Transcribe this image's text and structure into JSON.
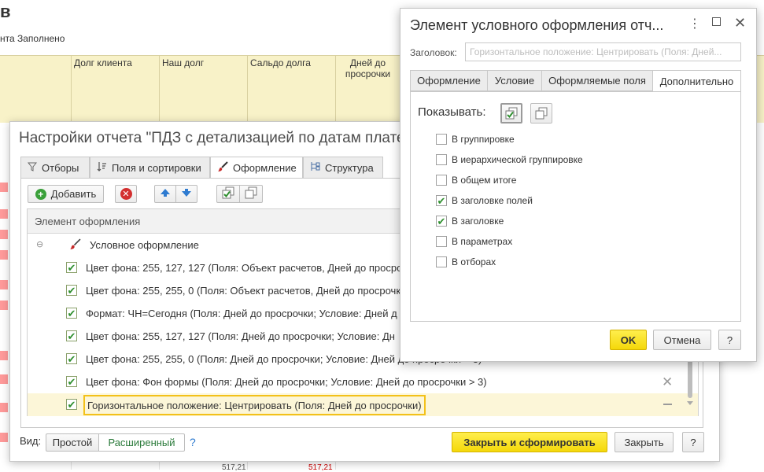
{
  "background_report": {
    "title_fragment": "в",
    "subtitle_fragment": "нта Заполнено",
    "headers": [
      "Долг клиента",
      "Наш долг",
      "Сальдо долга",
      "Дней до просрочки"
    ],
    "bottom_values": [
      "517,21",
      "517,21"
    ]
  },
  "settings_dialog": {
    "title": "Настройки отчета \"ПДЗ с детализацией по датам плате",
    "tabs": [
      {
        "label": "Отборы",
        "icon": "filter-icon"
      },
      {
        "label": "Поля и сортировки",
        "icon": "sort-icon"
      },
      {
        "label": "Оформление",
        "icon": "brush-icon"
      },
      {
        "label": "Структура",
        "icon": "structure-icon"
      }
    ],
    "active_tab": "Оформление",
    "toolbar": {
      "add_label": "Добавить"
    },
    "column_header": "Элемент оформления",
    "group_label": "Условное оформление",
    "rows": [
      {
        "text": "Цвет фона: 255, 127, 127 (Поля: Объект расчетов, Дней до просроч",
        "checked": true
      },
      {
        "text": "Цвет фона: 255, 255, 0 (Поля: Объект расчетов, Дней до просрочк",
        "checked": true
      },
      {
        "text": "Формат: ЧН=Сегодня (Поля: Дней до просрочки; Условие: Дней д",
        "checked": true
      },
      {
        "text": "Цвет фона: 255, 127, 127 (Поля: Дней до просрочки; Условие: Дн",
        "checked": true
      },
      {
        "text": "Цвет фона: 255, 255, 0 (Поля: Дней до просрочки; Условие: Дней до просрочки > 3)",
        "checked": true
      },
      {
        "text": "Цвет фона: Фон формы (Поля: Дней до просрочки; Условие: Дней до просрочки > 3)",
        "checked": true
      },
      {
        "text": "Горизонтальное положение: Центрировать (Поля: Дней до просрочки)",
        "checked": true
      }
    ],
    "view_label": "Вид:",
    "view_simple": "Простой",
    "view_extended": "Расширенный",
    "help": "?",
    "close_generate": "Закрыть и сформировать",
    "close": "Закрыть"
  },
  "conditional_dialog": {
    "title": "Элемент условного оформления отч...",
    "header_label": "Заголовок:",
    "header_placeholder": "Горизонтальное положение: Центрировать (Поля: Дней...",
    "tabs": [
      "Оформление",
      "Условие",
      "Оформляемые поля",
      "Дополнительно"
    ],
    "active_tab": "Дополнительно",
    "show_label": "Показывать:",
    "options": [
      {
        "label": "В группировке",
        "checked": false
      },
      {
        "label": "В иерархической группировке",
        "checked": false
      },
      {
        "label": "В общем итоге",
        "checked": false
      },
      {
        "label": "В заголовке полей",
        "checked": true
      },
      {
        "label": "В заголовке",
        "checked": true
      },
      {
        "label": "В параметрах",
        "checked": false
      },
      {
        "label": "В отборах",
        "checked": false
      }
    ],
    "ok": "OK",
    "cancel": "Отмена",
    "help": "?"
  },
  "colors": {
    "accent_yellow": "#f4d80a",
    "check_green": "#2f8f2f",
    "selection": "#fcf6d8"
  }
}
